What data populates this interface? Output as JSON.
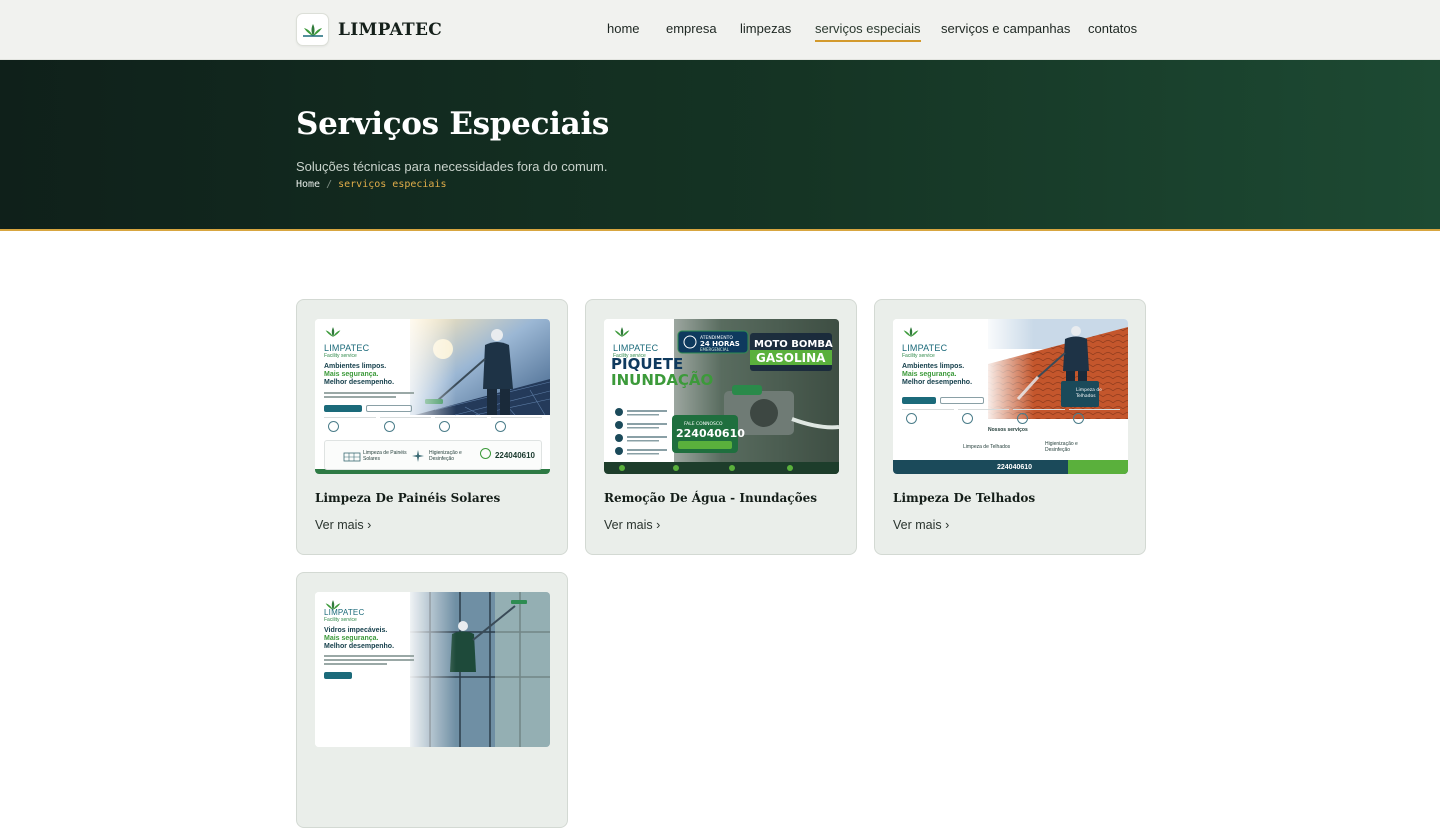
{
  "brand": {
    "name": "LIMPATEC"
  },
  "nav": {
    "items": [
      {
        "label": "home"
      },
      {
        "label": "empresa"
      },
      {
        "label": "limpezas"
      },
      {
        "label": "serviços especiais",
        "active": true
      },
      {
        "label": "serviços e campanhas"
      },
      {
        "label": "contatos"
      }
    ]
  },
  "hero": {
    "title": "Serviços Especiais",
    "subtitle": "Soluções técnicas para necessidades fora do comum.",
    "breadcrumb": {
      "home": "Home",
      "separator": "/",
      "current": "serviços especiais"
    }
  },
  "cards": [
    {
      "title": "Limpeza De Painéis Solares",
      "link": "Ver mais ›",
      "poster": {
        "brand": "LIMPATEC",
        "brand_sub": "Facility service",
        "line1": "Ambientes limpos.",
        "line2": "Mais segurança.",
        "line3": "Melhor desempenho.",
        "service": "Limpeza de Painéis Solares",
        "service2": "Higienização e Desinfeção",
        "phone": "224040610"
      }
    },
    {
      "title": "Remoção De Água - Inundações",
      "link": "Ver mais ›",
      "poster": {
        "brand": "LIMPATEC",
        "brand_sub": "Facility service",
        "badge": "ATENDIMENTO 24 HORAS EMERGENCIAL",
        "headline1": "PIQUETE",
        "headline2": "INUNDAÇÃO",
        "product1": "MOTO BOMBA",
        "product2": "GASOLINA",
        "phone": "224040610"
      }
    },
    {
      "title": "Limpeza De Telhados",
      "link": "Ver mais ›",
      "poster": {
        "brand": "LIMPATEC",
        "brand_sub": "Facility service",
        "line1": "Ambientes limpos.",
        "line2": "Mais segurança.",
        "line3": "Melhor desempenho.",
        "section": "Nossos serviços",
        "service": "Limpeza de Telhados",
        "service2": "Higienização e Desinfeção",
        "phone": "224040610"
      }
    },
    {
      "title": "",
      "link": "",
      "poster": {
        "brand": "LIMPATEC",
        "brand_sub": "Facility service",
        "line1": "Vidros impecáveis.",
        "line2": "Mais segurança.",
        "line3": "Melhor desempenho."
      }
    }
  ],
  "colors": {
    "accent": "#d39a2d",
    "hero_dark": "#0f201a",
    "hero_green": "#1d4a33",
    "card_bg": "#eaeeea",
    "brand_teal": "#1b6a7a",
    "brand_green": "#3c9a3a"
  },
  "icons": [
    "leaf-logo-icon",
    "shield-icon",
    "gear-icon",
    "leaf-icon",
    "worker-icon",
    "solar-panel-icon",
    "sparkle-icon",
    "phone-icon"
  ]
}
